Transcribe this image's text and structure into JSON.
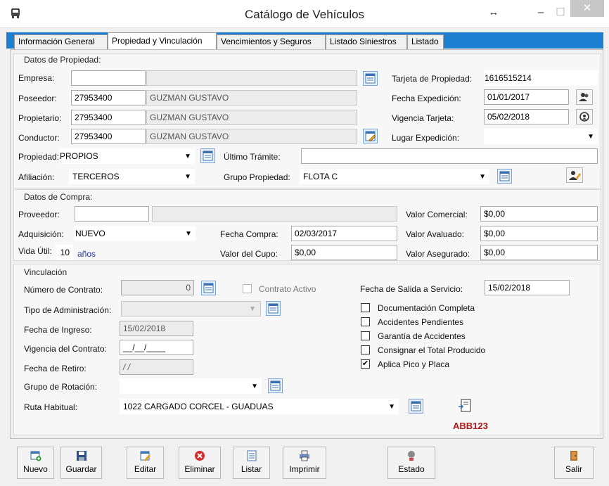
{
  "window": {
    "title": "Catálogo de Vehículos",
    "restore_glyph": "↔",
    "minimize_glyph": "–",
    "maximize_glyph": "☐",
    "close_glyph": "✕",
    "icon": "bus-icon"
  },
  "tabs": [
    {
      "label": "Información General",
      "active": false
    },
    {
      "label": "Propiedad y Vinculación",
      "active": true
    },
    {
      "label": "Vencimientos y Seguros",
      "active": false
    },
    {
      "label": "Listado Siniestros",
      "active": false
    },
    {
      "label": "Listado",
      "active": false
    }
  ],
  "propiedad": {
    "title": "Datos de Propiedad:",
    "empresa_label": "Empresa:",
    "empresa_code": "",
    "empresa_name": "",
    "poseedor_label": "Poseedor:",
    "poseedor_code": "27953400",
    "poseedor_name": "GUZMAN GUSTAVO",
    "propietario_label": "Propietario:",
    "propietario_code": "27953400",
    "propietario_name": "GUZMAN GUSTAVO",
    "conductor_label": "Conductor:",
    "conductor_code": "27953400",
    "conductor_name": "GUZMAN GUSTAVO",
    "tarjeta_label": "Tarjeta de Propiedad:",
    "tarjeta_value": "1616515214",
    "fecha_exp_label": "Fecha Expedición:",
    "fecha_exp_value": "01/01/2017",
    "vigencia_label": "Vigencia Tarjeta:",
    "vigencia_value": "05/02/2018",
    "lugar_label": "Lugar Expedición:",
    "lugar_value": "",
    "propiedad_label": "Propiedad:",
    "propiedad_value": "PROPIOS",
    "ultimo_label": "Último Trámite:",
    "ultimo_value": "",
    "afiliacion_label": "Afiliación:",
    "afiliacion_value": "TERCEROS",
    "grupo_label": "Grupo Propiedad:",
    "grupo_value": "FLOTA C"
  },
  "compra": {
    "title": "Datos de Compra:",
    "proveedor_label": "Proveedor:",
    "proveedor_code": "",
    "proveedor_name": "",
    "adquisicion_label": "Adquisición:",
    "adquisicion_value": "NUEVO",
    "vida_label": "Vida Útil:",
    "vida_value": "10",
    "vida_unit": "años",
    "fecha_compra_label": "Fecha Compra:",
    "fecha_compra_value": "02/03/2017",
    "cupo_label": "Valor del Cupo:",
    "cupo_value": "$0,00",
    "comercial_label": "Valor Comercial:",
    "comercial_value": "$0,00",
    "avaluado_label": "Valor Avaluado:",
    "avaluado_value": "$0,00",
    "asegurado_label": "Valor Asegurado:",
    "asegurado_value": "$0,00"
  },
  "vinculacion": {
    "title": "Vinculación",
    "contrato_label": "Número de Contrato:",
    "contrato_value": "0",
    "activo_label": "Contrato Activo",
    "tipo_label": "Tipo de Administración:",
    "tipo_value": "",
    "ingreso_label": "Fecha de Ingreso:",
    "ingreso_value": "15/02/2018",
    "vigencia_label": "Vigencia del Contrato:",
    "vigencia_value": "__/__/____",
    "retiro_label": "Fecha de Retiro:",
    "retiro_value": "/ /",
    "rotacion_label": "Grupo de Rotación:",
    "rotacion_value": "",
    "ruta_label": "Ruta Habitual:",
    "ruta_value": "1022 CARGADO CORCEL - GUADUAS",
    "salida_label": "Fecha de Salida a Servicio:",
    "salida_value": "15/02/2018",
    "checks": [
      {
        "label": "Documentación Completa",
        "checked": false
      },
      {
        "label": "Accidentes Pendientes",
        "checked": false
      },
      {
        "label": "Garantía de Accidentes",
        "checked": false
      },
      {
        "label": "Consignar el Total Producido",
        "checked": false
      },
      {
        "label": "Aplica Pico y Placa",
        "checked": true
      }
    ],
    "check_glyph": "✔",
    "placa": "ABB123"
  },
  "toolbar": {
    "nuevo": "Nuevo",
    "guardar": "Guardar",
    "editar": "Editar",
    "eliminar": "Eliminar",
    "listar": "Listar",
    "imprimir": "Imprimir",
    "estado": "Estado",
    "salir": "Salir"
  },
  "colors": {
    "tab_strip": "#1e7fd1",
    "placa": "#b01818",
    "link_blue": "#2a3aa0"
  }
}
